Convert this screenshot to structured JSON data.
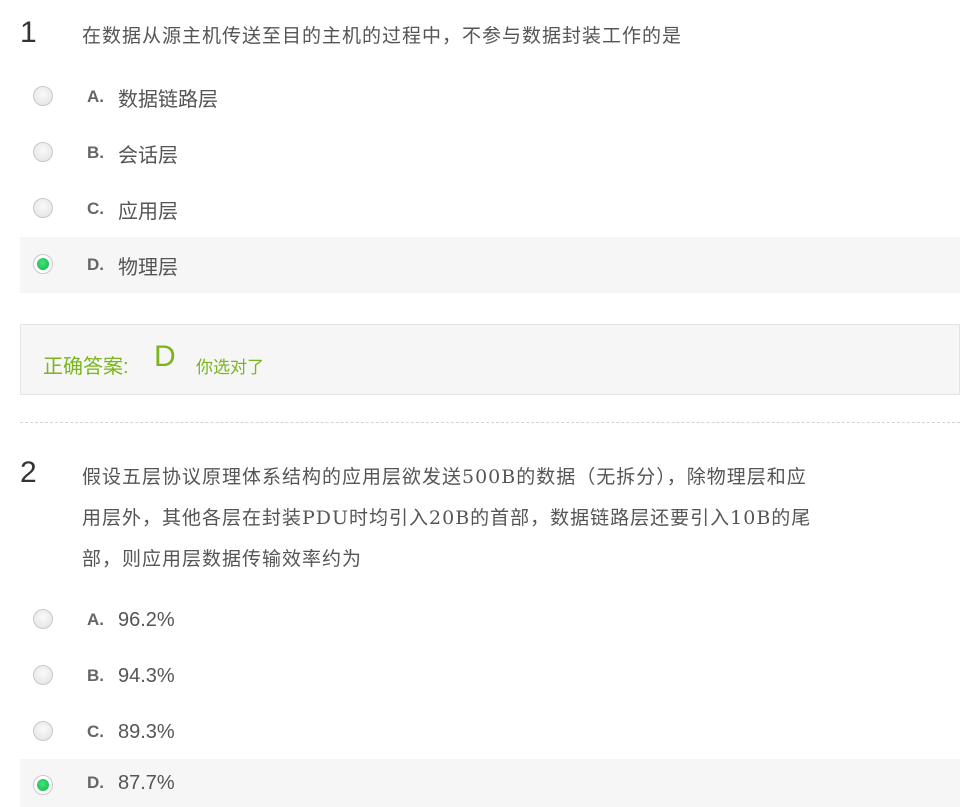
{
  "questions": [
    {
      "number": "1",
      "text": "在数据从源主机传送至目的主机的过程中，不参与数据封装工作的是",
      "options": [
        {
          "letter": "A.",
          "text": "数据链路层",
          "selected": false
        },
        {
          "letter": "B.",
          "text": "会话层",
          "selected": false
        },
        {
          "letter": "C.",
          "text": "应用层",
          "selected": false
        },
        {
          "letter": "D.",
          "text": "物理层",
          "selected": true
        }
      ],
      "answer": {
        "label": "正确答案:",
        "letter": "D",
        "status": "你选对了"
      }
    },
    {
      "number": "2",
      "text_lines": [
        "假设五层协议原理体系结构的应用层欲发送500B的数据（无拆分），除物理层和应",
        "用层外，其他各层在封装PDU时均引入20B的首部，数据链路层还要引入10B的尾",
        "部，则应用层数据传输效率约为"
      ],
      "options": [
        {
          "letter": "A.",
          "text": "96.2%",
          "selected": false
        },
        {
          "letter": "B.",
          "text": "94.3%",
          "selected": false
        },
        {
          "letter": "C.",
          "text": "89.3%",
          "selected": false
        },
        {
          "letter": "D.",
          "text": "87.7%",
          "selected": true
        }
      ]
    }
  ],
  "colors": {
    "accent_green": "#79b51c",
    "radio_checked": "#1ec95a",
    "selected_row_bg": "#f6f6f6"
  }
}
